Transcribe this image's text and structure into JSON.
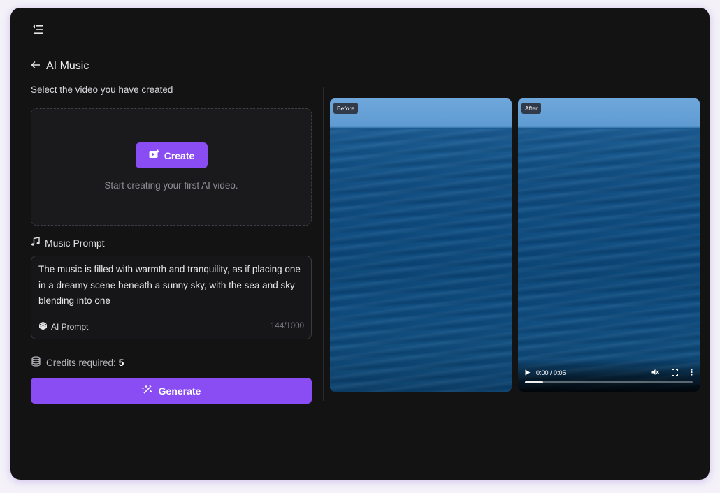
{
  "header": {
    "menu_icon": "sidebar-collapse-icon"
  },
  "page": {
    "back_icon": "arrow-left-icon",
    "title": "AI Music"
  },
  "video_select": {
    "label": "Select the video you have created",
    "create_button": "Create",
    "create_icon": "video-add-icon",
    "hint": "Start creating your first AI video."
  },
  "music_prompt": {
    "label": "Music Prompt",
    "icon": "music-note-icon",
    "text": "The music is filled with warmth and tranquility, as if placing one in a dreamy scene beneath a sunny sky, with the sea and sky blending into one",
    "ai_prompt_label": "AI Prompt",
    "ai_prompt_icon": "dice-icon",
    "counter": "144/1000"
  },
  "credits": {
    "label": "Credits required:",
    "value": "5",
    "icon": "coins-stack-icon"
  },
  "generate": {
    "label": "Generate",
    "icon": "magic-wand-icon"
  },
  "previews": {
    "before": {
      "tag": "Before"
    },
    "after": {
      "tag": "After",
      "time": "0:00 / 0:05",
      "progress": 0.11,
      "play_icon": "play-icon",
      "mute_icon": "volume-muted-icon",
      "fullscreen_icon": "fullscreen-icon",
      "more_icon": "more-vertical-icon"
    }
  },
  "colors": {
    "accent": "#8a4cf3",
    "background": "#131314",
    "panel": "#1a1a1d"
  }
}
